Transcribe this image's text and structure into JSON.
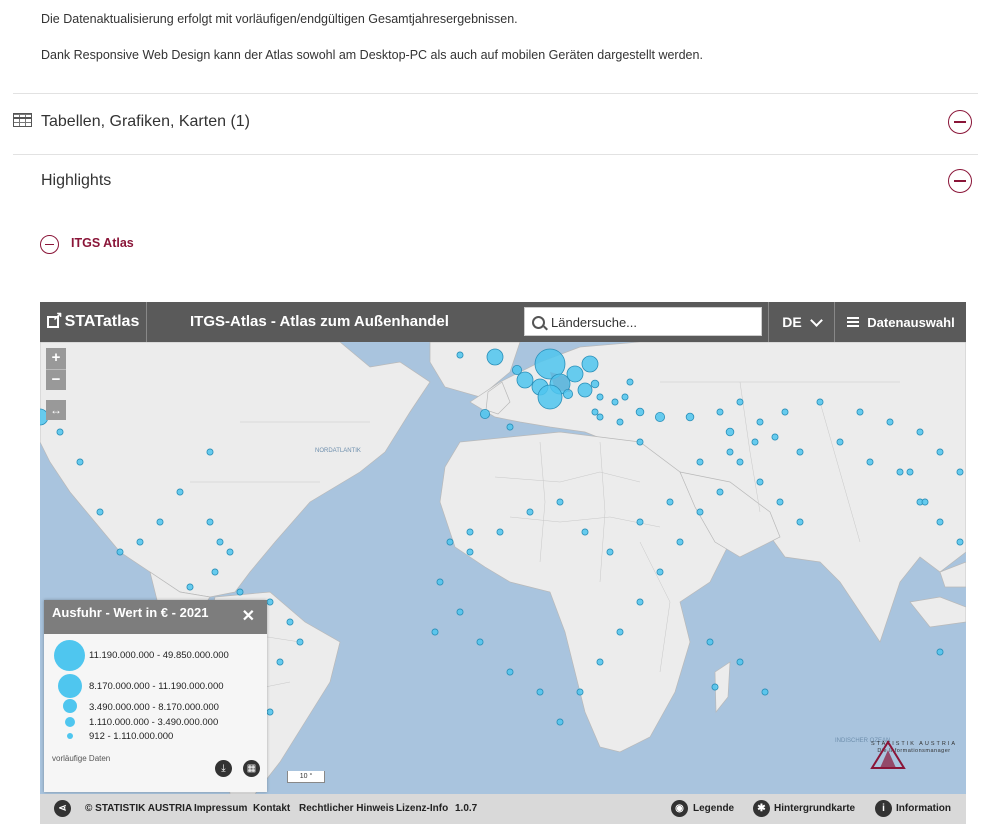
{
  "intro": {
    "line1": "Die Datenaktualisierung erfolgt mit vorläufigen/endgültigen Gesamtjahresergebnissen.",
    "line2": "Dank Responsive Web Design kann der Atlas sowohl am Desktop-PC als auch auf mobilen Geräten dargestellt werden."
  },
  "accordion": {
    "tables_title": "Tabellen, Grafiken, Karten (1)",
    "highlights_title": "Highlights",
    "itgs_link": "ITGS Atlas"
  },
  "atlas": {
    "logo": "STATatlas",
    "title": "ITGS-Atlas - Atlas zum Außenhandel",
    "search_placeholder": "Ländersuche...",
    "language": "DE",
    "data_selection": "Datenauswahl",
    "zoom_in": "+",
    "zoom_out": "−",
    "scale_label": "10 °",
    "brand": "STATISTIK AUSTRIA",
    "brand_sub": "Die Informationsmanager",
    "map_labels": {
      "north_atlantic": "NORDATLANTIK",
      "indian_ocean": "INDISCHER OZEAN"
    },
    "colors": {
      "bubble": "#4fc6ef",
      "land": "#ececec",
      "sea": "#a9c4de",
      "austria": "#e8747c",
      "accent": "#8a1538"
    }
  },
  "legend": {
    "title": "Ausfuhr - Wert in € - 2021",
    "classes": [
      "11.190.000.000 - 49.850.000.000",
      "8.170.000.000 - 11.190.000.000",
      "3.490.000.000 - 8.170.000.000",
      "1.110.000.000 - 3.490.000.000",
      "912 - 1.110.000.000"
    ],
    "note": "vorläufige Daten"
  },
  "footer": {
    "copyright": "© STATISTIK AUSTRIA",
    "impressum": "Impressum",
    "kontakt": "Kontakt",
    "rechtlicher_hinweis": "Rechtlicher Hinweis",
    "lizenz": "Lizenz-Info",
    "version": "1.0.7",
    "legende": "Legende",
    "hintergrundkarte": "Hintergrundkarte",
    "information": "Information"
  }
}
